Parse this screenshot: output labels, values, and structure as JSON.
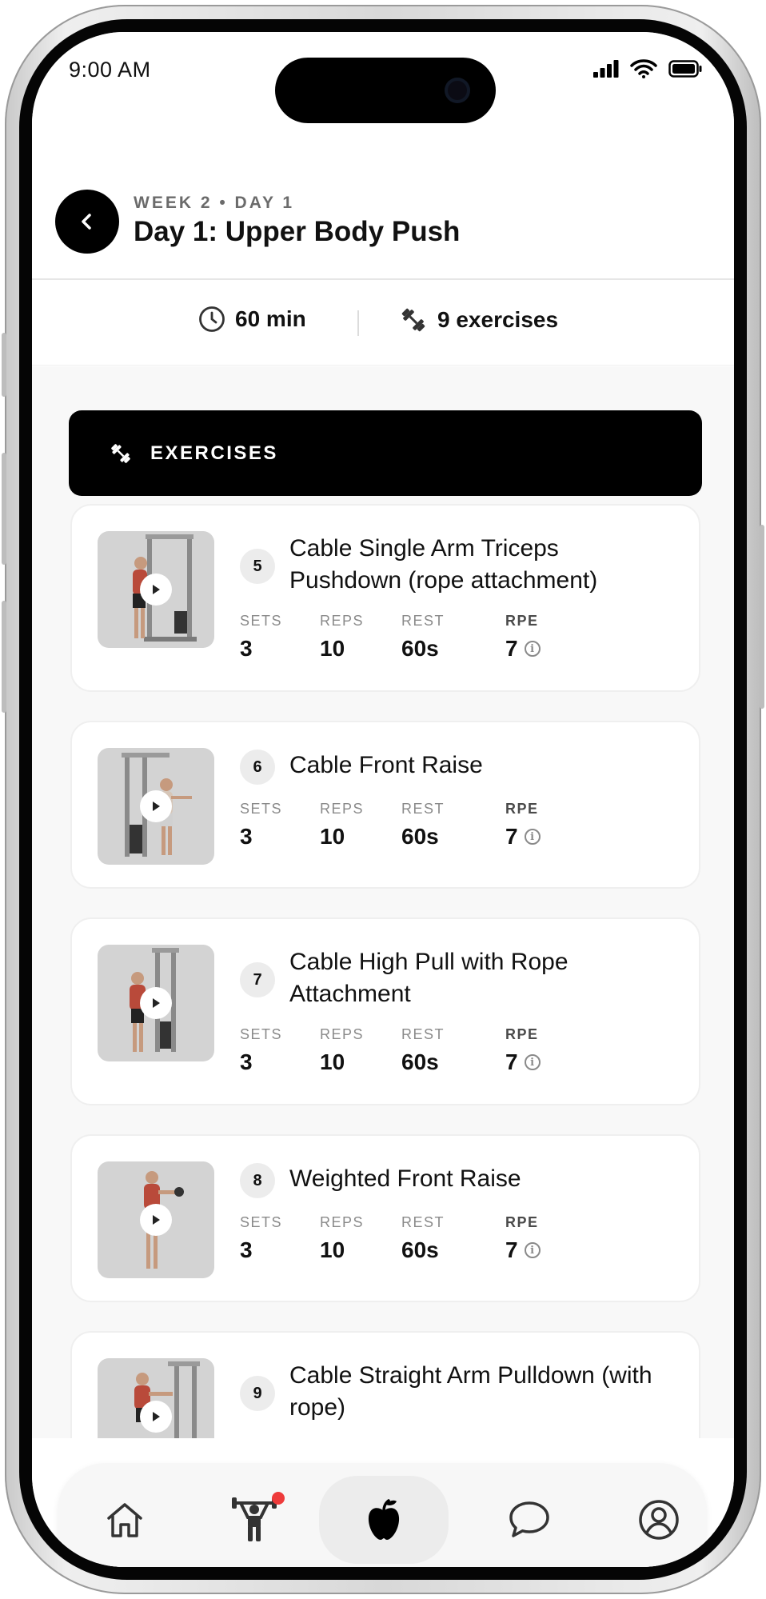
{
  "status_bar": {
    "time": "9:00 AM"
  },
  "header": {
    "eyebrow": "WEEK 2 • DAY 1",
    "title": "Day 1: Upper Body Push"
  },
  "stats": {
    "duration": "60 min",
    "exercises": "9 exercises"
  },
  "section": {
    "label": "EXERCISES"
  },
  "metric_labels": {
    "sets": "SETS",
    "reps": "REPS",
    "rest": "REST",
    "rpe": "RPE"
  },
  "exercises": [
    {
      "number": "5",
      "name": "Cable Single Arm Triceps Pushdown (rope attachment)",
      "sets": "3",
      "reps": "10",
      "rest": "60s",
      "rpe": "7"
    },
    {
      "number": "6",
      "name": "Cable Front Raise",
      "sets": "3",
      "reps": "10",
      "rest": "60s",
      "rpe": "7"
    },
    {
      "number": "7",
      "name": "Cable High Pull with Rope Attachment",
      "sets": "3",
      "reps": "10",
      "rest": "60s",
      "rpe": "7"
    },
    {
      "number": "8",
      "name": "Weighted Front Raise",
      "sets": "3",
      "reps": "10",
      "rest": "60s",
      "rpe": "7"
    },
    {
      "number": "9",
      "name": "Cable Straight Arm Pulldown (with rope)"
    }
  ],
  "tab_bar": {
    "items": [
      {
        "icon": "home-icon",
        "active": false
      },
      {
        "icon": "workout-icon",
        "active": false,
        "has_notification": true
      },
      {
        "icon": "nutrition-apple-icon",
        "active": true
      },
      {
        "icon": "chat-icon",
        "active": false
      },
      {
        "icon": "profile-icon",
        "active": false
      }
    ]
  },
  "colors": {
    "accent": "#000000",
    "notification": "#ee3b3b",
    "background": "#f8f8f8"
  }
}
